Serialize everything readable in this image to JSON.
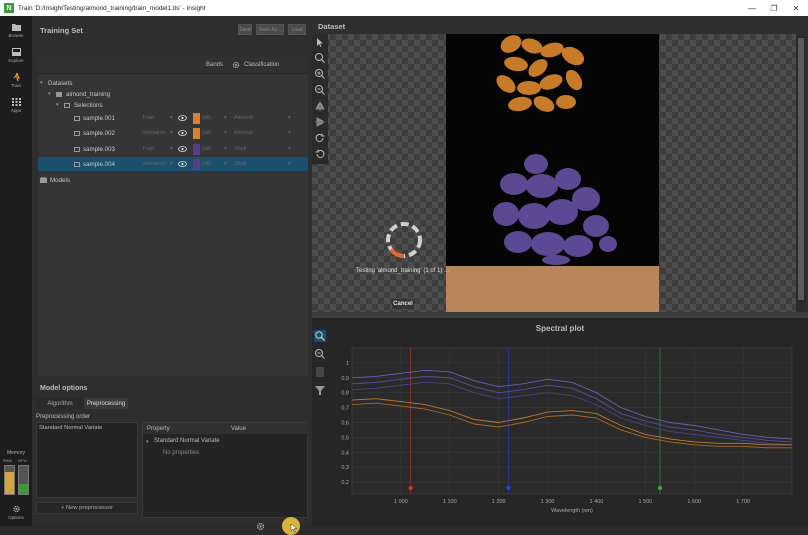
{
  "window": {
    "title": "Train 'D:/InsightTesting/almond_training/train_model1.its' - Insight",
    "logo_letter": "N",
    "minimize": "—",
    "maximize": "❐",
    "close": "✕"
  },
  "sidebar": {
    "items": [
      {
        "label": "Browse",
        "icon": "folder-icon"
      },
      {
        "label": "Explore",
        "icon": "explore-icon"
      },
      {
        "label": "Train",
        "icon": "train-icon"
      },
      {
        "label": "Apps",
        "icon": "apps-icon"
      }
    ],
    "memory": {
      "label": "Memory",
      "ram_label": "RAM",
      "gpu_label": "GPU",
      "ram_fraction": 0.8,
      "gpu_fraction": 0.35
    },
    "options_label": "Options"
  },
  "training_set": {
    "title": "Training Set",
    "buttons": [
      "Save",
      "Save As...",
      "Load"
    ],
    "tabs": {
      "bands": "Bands",
      "classification": "Classification"
    },
    "tree": {
      "datasets_label": "Datasets",
      "dataset_name": "almond_training",
      "selections_label": "Selections",
      "samples": [
        {
          "name": "sample.001",
          "role": "Train",
          "swatch_label": "(all)",
          "class": "Almond",
          "color": "#d9822b"
        },
        {
          "name": "sample.002",
          "role": "Validation",
          "swatch_label": "(all)",
          "class": "Almond",
          "color": "#d9822b"
        },
        {
          "name": "sample.003",
          "role": "Train",
          "swatch_label": "(all)",
          "class": "Shell",
          "color": "#5a3d8a"
        },
        {
          "name": "sample.004",
          "role": "Validation",
          "swatch_label": "(all)",
          "class": "Shell",
          "color": "#5a3d8a"
        }
      ],
      "models_label": "Models"
    }
  },
  "model_options": {
    "title": "Model options",
    "tabs": [
      "Algorithm",
      "Preprocessing"
    ],
    "preprocessing_order_label": "Preprocessing order",
    "preprocessors": [
      "Standard Normal Variate"
    ],
    "new_preprocessor": "+ New preprocessor",
    "property_header": "Property",
    "value_header": "Value",
    "group": "Standard Normal Variate",
    "no_properties": "No properties"
  },
  "dataset_view": {
    "title": "Dataset",
    "status": "Testing 'almond_training' (1 of 1) ...",
    "cancel": "Cancel",
    "progress": 0.15
  },
  "spectral_plot": {
    "title": "Spectral plot",
    "xlabel": "Wavelength (nm)",
    "x_ticks": [
      1000,
      1100,
      1200,
      1300,
      1400,
      1500,
      1600,
      1700
    ],
    "x_tick_labels": [
      "1 000",
      "1 100",
      "1 200",
      "1 300",
      "1 400",
      "1 500",
      "1 600",
      "1 700"
    ],
    "y_ticks": [
      0.2,
      0.3,
      0.4,
      0.5,
      0.6,
      0.7,
      0.8,
      0.9,
      1
    ],
    "y_tick_labels": [
      "0,2",
      "0,3",
      "0,4",
      "0,5",
      "0,6",
      "0,7",
      "0,8",
      "0,9",
      "1"
    ],
    "xlim": [
      900,
      1800
    ],
    "ylim": [
      0.12,
      1.1
    ],
    "band_markers": [
      {
        "x": 1020,
        "color": "#c0392b"
      },
      {
        "x": 1220,
        "color": "#2a3fd6"
      },
      {
        "x": 1530,
        "color": "#2fa84f"
      }
    ]
  },
  "chart_data": {
    "type": "line",
    "title": "Spectral plot",
    "xlabel": "Wavelength (nm)",
    "ylabel": "",
    "xlim": [
      900,
      1800
    ],
    "ylim": [
      0.12,
      1.1
    ],
    "grid": true,
    "x": [
      900,
      950,
      1000,
      1050,
      1100,
      1150,
      1200,
      1250,
      1300,
      1350,
      1400,
      1450,
      1500,
      1550,
      1600,
      1650,
      1700,
      1750,
      1800
    ],
    "series": [
      {
        "color": "#6a5fb0",
        "values": [
          0.9,
          0.91,
          0.93,
          0.95,
          0.94,
          0.88,
          0.84,
          0.86,
          0.89,
          0.87,
          0.8,
          0.7,
          0.64,
          0.6,
          0.58,
          0.55,
          0.52,
          0.5,
          0.49
        ]
      },
      {
        "color": "#5a4fa0",
        "values": [
          0.86,
          0.87,
          0.89,
          0.91,
          0.9,
          0.84,
          0.8,
          0.82,
          0.85,
          0.83,
          0.76,
          0.66,
          0.61,
          0.57,
          0.55,
          0.52,
          0.5,
          0.48,
          0.47
        ]
      },
      {
        "color": "#4a4290",
        "values": [
          0.82,
          0.83,
          0.85,
          0.87,
          0.86,
          0.8,
          0.76,
          0.78,
          0.8,
          0.78,
          0.72,
          0.63,
          0.58,
          0.54,
          0.52,
          0.5,
          0.48,
          0.46,
          0.45
        ]
      },
      {
        "color": "#c07a2a",
        "values": [
          0.75,
          0.76,
          0.74,
          0.72,
          0.68,
          0.62,
          0.6,
          0.63,
          0.67,
          0.68,
          0.66,
          0.58,
          0.52,
          0.49,
          0.47,
          0.46,
          0.46,
          0.45,
          0.45
        ]
      },
      {
        "color": "#a86a28",
        "values": [
          0.72,
          0.73,
          0.71,
          0.69,
          0.65,
          0.59,
          0.57,
          0.6,
          0.64,
          0.65,
          0.63,
          0.55,
          0.5,
          0.47,
          0.45,
          0.44,
          0.44,
          0.43,
          0.43
        ]
      }
    ]
  }
}
